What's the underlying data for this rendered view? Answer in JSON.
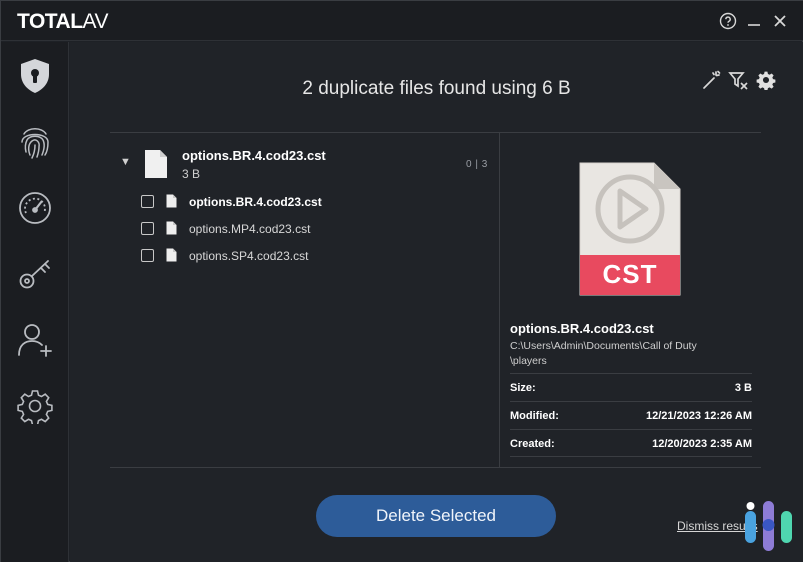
{
  "app": {
    "logo_bold": "TOTAL",
    "logo_light": "AV"
  },
  "window_controls": {
    "help_icon": "help-icon",
    "minimize_icon": "minimize-icon",
    "close_icon": "close-icon"
  },
  "sidebar": {
    "items": [
      {
        "icon": "shield-icon"
      },
      {
        "icon": "fingerprint-icon"
      },
      {
        "icon": "speedometer-icon"
      },
      {
        "icon": "key-icon"
      },
      {
        "icon": "add-user-icon"
      },
      {
        "icon": "gear-icon"
      }
    ]
  },
  "main": {
    "headline": "2 duplicate files found using 6 B",
    "tools": [
      "magic-wand-icon",
      "filter-icon",
      "gear-icon"
    ]
  },
  "group": {
    "name": "options.BR.4.cod23.cst",
    "size": "3 B",
    "count": "0 | 3",
    "files": [
      {
        "name": "options.BR.4.cod23.cst",
        "bold": true
      },
      {
        "name": "options.MP4.cod23.cst",
        "bold": false
      },
      {
        "name": "options.SP4.cod23.cst",
        "bold": false
      }
    ]
  },
  "details": {
    "preview_label": "CST",
    "file_name": "options.BR.4.cod23.cst",
    "path_line1": "C:\\Users\\Admin\\Documents\\Call of Duty",
    "path_line2": "\\players",
    "rows": [
      {
        "label": "Size:",
        "value": "3 B"
      },
      {
        "label": "Modified:",
        "value": "12/21/2023 12:26 AM"
      },
      {
        "label": "Created:",
        "value": "12/20/2023 2:35 AM"
      }
    ]
  },
  "actions": {
    "delete_label": "Delete Selected",
    "dismiss_label": "Dismiss results"
  },
  "colors": {
    "accent": "#2d5c99",
    "cst_badge": "#e84a5f",
    "background": "#202328"
  }
}
